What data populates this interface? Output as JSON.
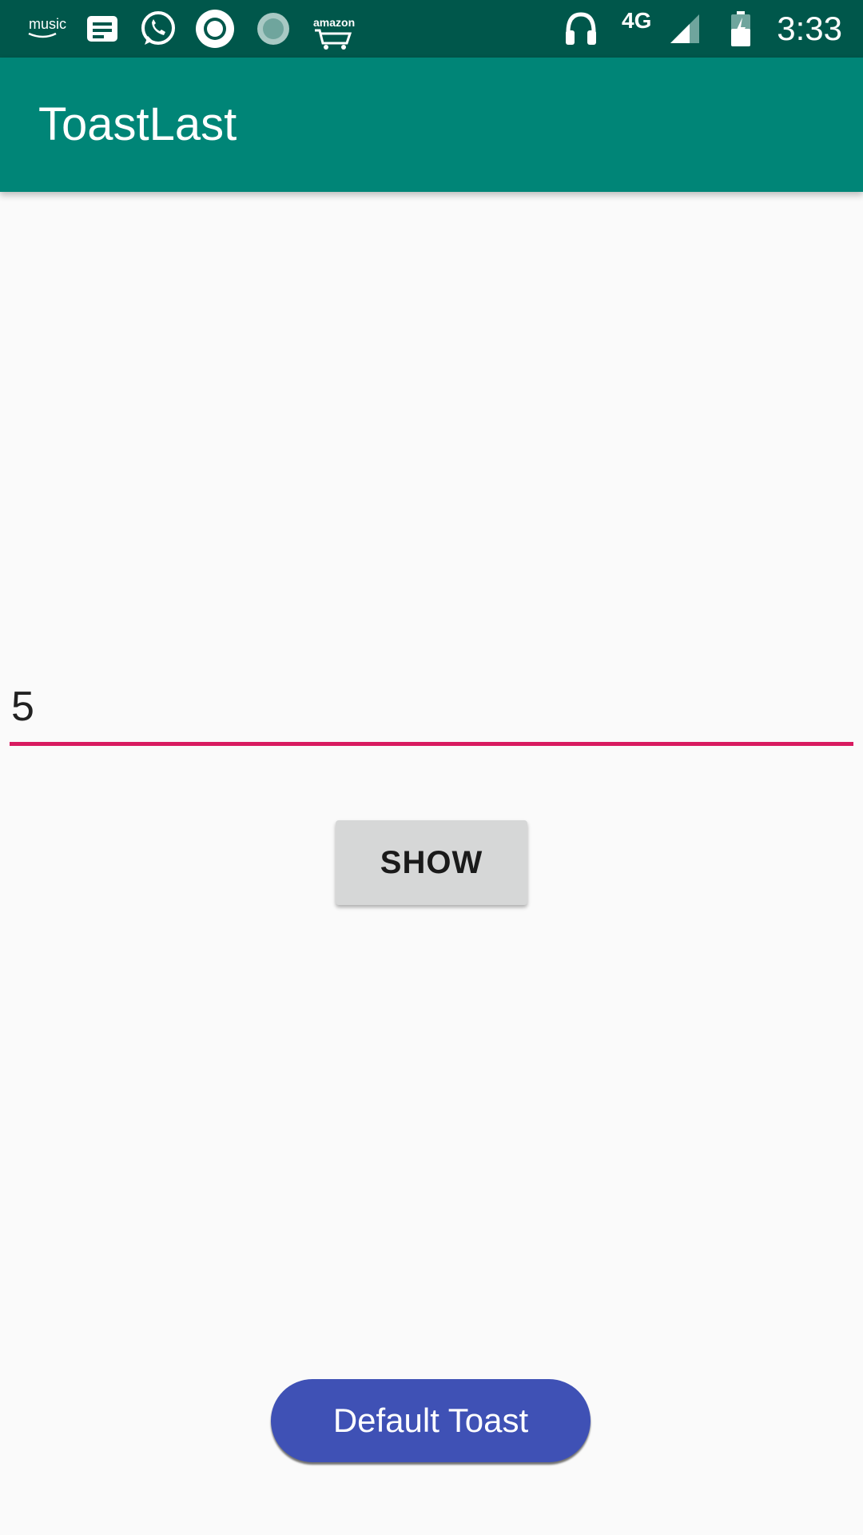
{
  "status_bar": {
    "time": "3:33",
    "network": "4G",
    "music_label": "music",
    "amazon_label": "amazon",
    "icons": [
      "amazon-music-icon",
      "messages-icon",
      "whatsapp-icon",
      "circle-app-icon",
      "spinner-app-icon",
      "amazon-shopping-icon",
      "headset-icon",
      "signal-icon",
      "battery-charging-icon"
    ],
    "background": "#00574b"
  },
  "app_bar": {
    "title": "ToastLast",
    "background": "#008577"
  },
  "form": {
    "input_value": "5",
    "underline_color": "#d81b60",
    "show_button_label": "SHOW"
  },
  "footer": {
    "default_toast_label": "Default Toast",
    "button_color": "#3f51b5"
  }
}
